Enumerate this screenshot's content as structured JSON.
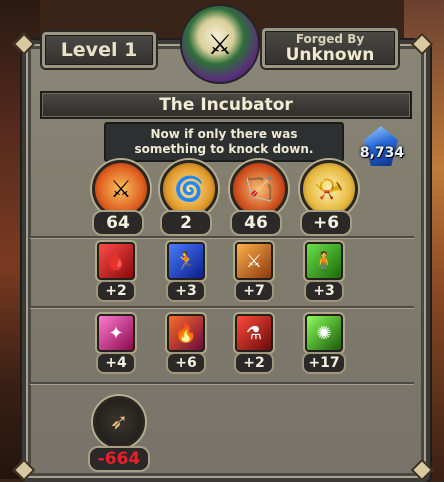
{
  "header": {
    "level": "Level 1",
    "forged_by_label": "Forged By",
    "forged_by_name": "Unknown"
  },
  "item": {
    "name": "The Incubator",
    "description_line1": "Now if only there was",
    "description_line2": "something to knock down."
  },
  "currency": {
    "gems": "8,734",
    "icon": "blue-gem-icon"
  },
  "stats": [
    {
      "icon": "crossed-swords-icon",
      "value": "64"
    },
    {
      "icon": "swirl-speed-icon",
      "value": "2"
    },
    {
      "icon": "quiver-arrows-icon",
      "value": "46"
    },
    {
      "icon": "golden-horn-icon",
      "value": "+6"
    }
  ],
  "abilities_row1": [
    {
      "icon": "blood-drop-icon",
      "value": "+2"
    },
    {
      "icon": "running-figure-icon",
      "value": "+3"
    },
    {
      "icon": "crossed-blades-icon",
      "value": "+7"
    },
    {
      "icon": "staff-figure-icon",
      "value": "+3"
    }
  ],
  "abilities_row2": [
    {
      "icon": "pink-burst-icon",
      "value": "+4"
    },
    {
      "icon": "flame-strike-icon",
      "value": "+6"
    },
    {
      "icon": "potion-icon",
      "value": "+2"
    },
    {
      "icon": "green-sparks-icon",
      "value": "+17"
    }
  ],
  "penalty": {
    "icon": "arrow-icon",
    "value": "-664"
  },
  "colors": {
    "panel": "#807c6d",
    "penalty_text": "#e8202a",
    "gem": "#2a6ad8"
  }
}
